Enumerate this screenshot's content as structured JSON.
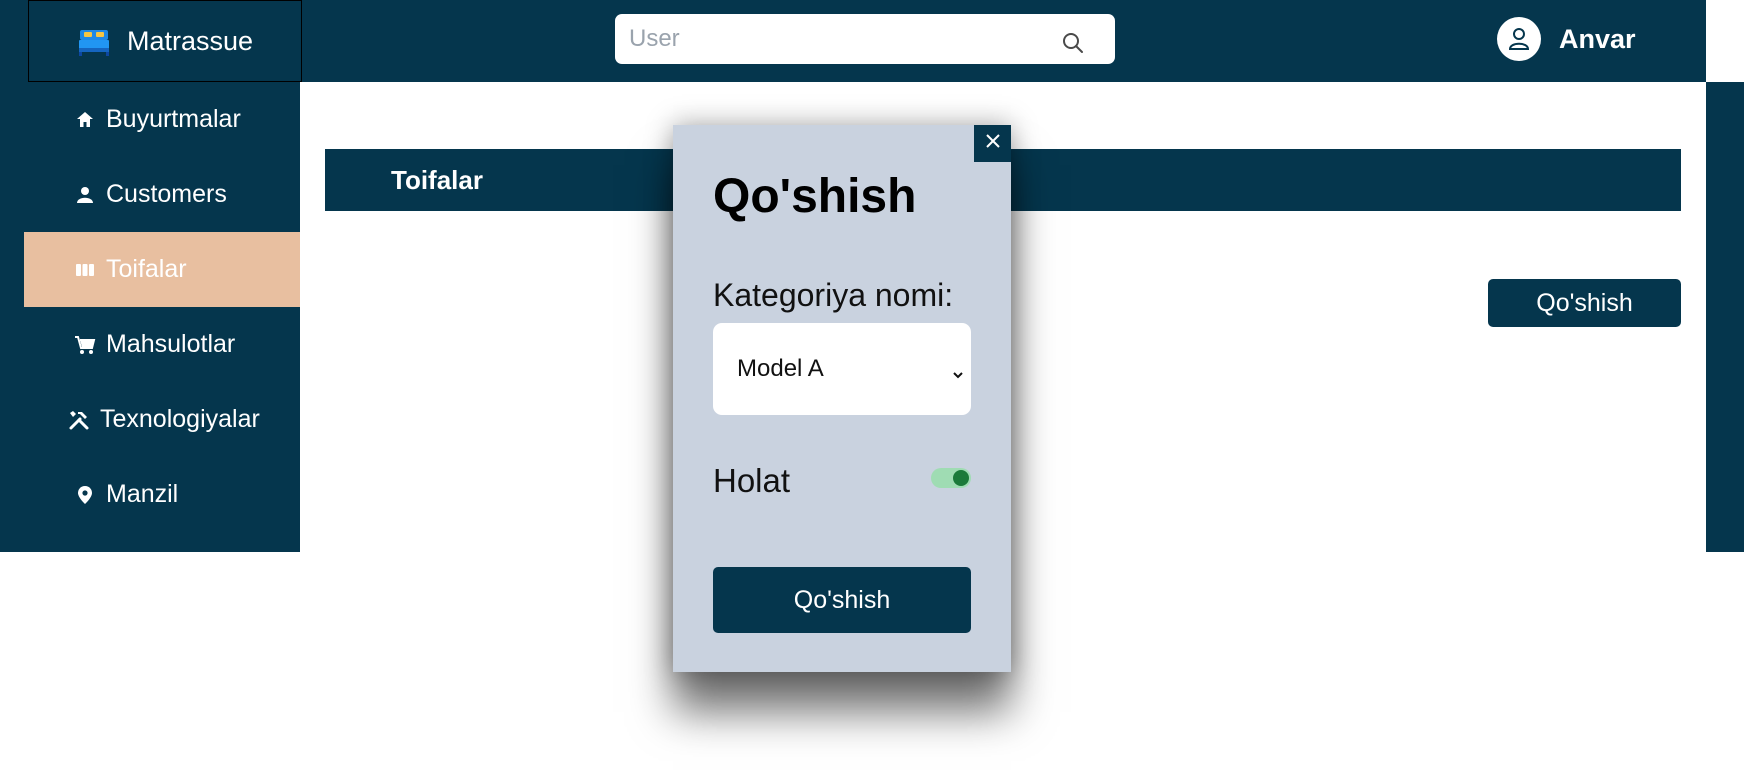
{
  "brand": {
    "name": "Matrassue",
    "icon": "bed-icon"
  },
  "search": {
    "placeholder": "User",
    "value": "",
    "icon": "search-icon"
  },
  "user": {
    "name": "Anvar",
    "icon": "user-icon"
  },
  "sidebar": {
    "items": [
      {
        "label": "Buyurtmalar",
        "icon": "home-icon",
        "active": false
      },
      {
        "label": "Customers",
        "icon": "person-icon",
        "active": false
      },
      {
        "label": "Toifalar",
        "icon": "columns-icon",
        "active": true
      },
      {
        "label": "Mahsulotlar",
        "icon": "cart-icon",
        "active": false
      },
      {
        "label": "Texnologiyalar",
        "icon": "tools-icon",
        "active": false
      },
      {
        "label": "Manzil",
        "icon": "location-pin-icon",
        "active": false
      }
    ]
  },
  "main": {
    "section_title": "Toifalar",
    "add_button": "Qo'shish"
  },
  "modal": {
    "title": "Qo'shish",
    "category_label": "Kategoriya nomi:",
    "category_selected": "Model A",
    "status_label": "Holat",
    "status_on": true,
    "submit_label": "Qo'shish",
    "close_icon": "close-icon"
  },
  "colors": {
    "primary": "#05364d",
    "active_nav": "#e8bfa0",
    "modal_bg": "#c9d2df",
    "toggle_on_track": "#9fdcb3",
    "toggle_on_knob": "#1b7a3a"
  }
}
